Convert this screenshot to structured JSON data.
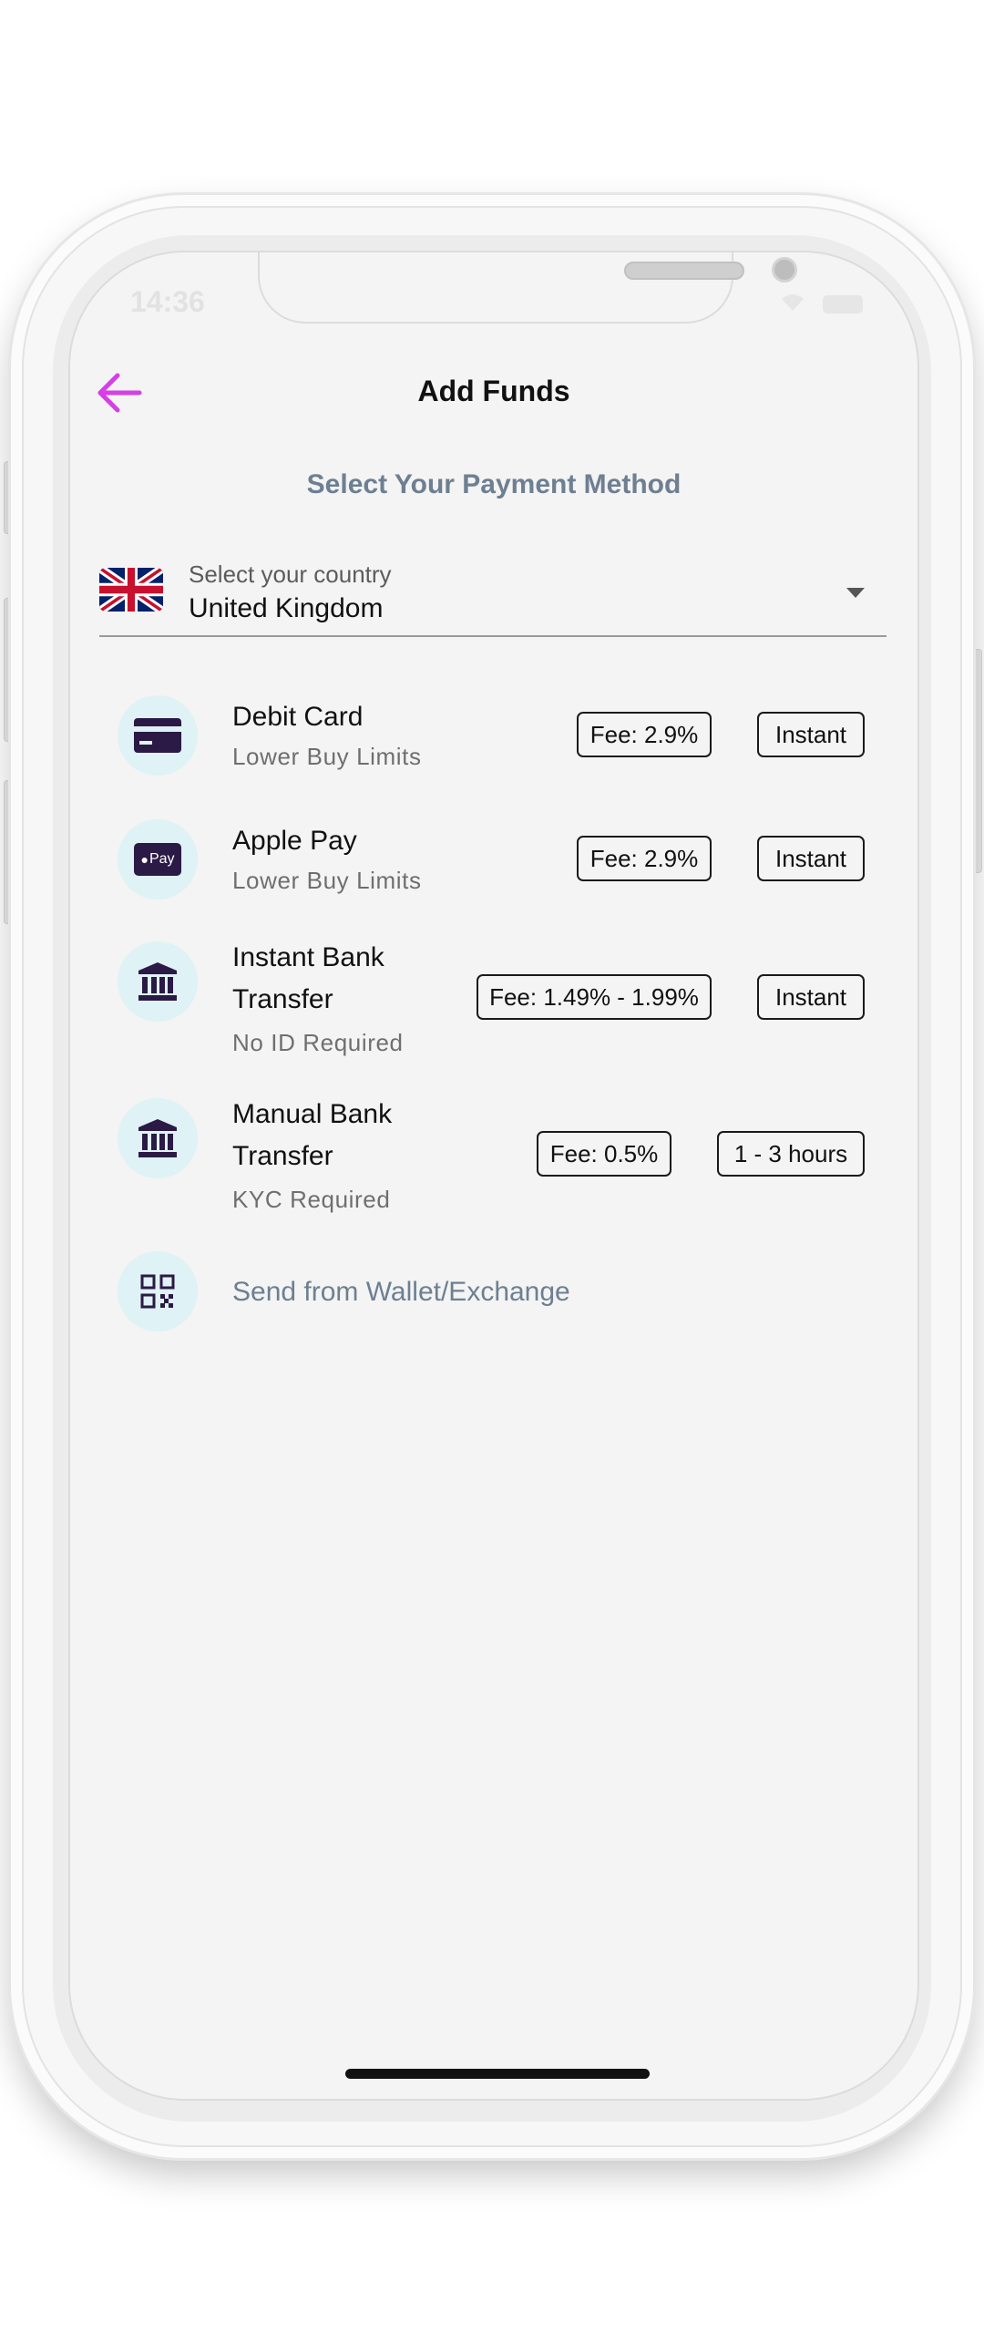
{
  "status_bar": {
    "time": "14:36"
  },
  "header": {
    "title": "Add Funds"
  },
  "section_title": "Select Your Payment Method",
  "country": {
    "label": "Select your country",
    "value": "United Kingdom"
  },
  "methods": [
    {
      "name": "Debit Card",
      "subtitle": "Lower Buy Limits",
      "fee": "Fee: 2.9%",
      "speed": "Instant",
      "icon": "credit-card-icon"
    },
    {
      "name": "Apple Pay",
      "subtitle": "Lower Buy Limits",
      "fee": "Fee: 2.9%",
      "speed": "Instant",
      "icon": "apple-pay-icon",
      "icon_text": "Pay"
    },
    {
      "name_line1": "Instant Bank",
      "name_line2": "Transfer",
      "subtitle": "No ID Required",
      "fee": "Fee: 1.49% - 1.99%",
      "speed": "Instant",
      "icon": "bank-icon"
    },
    {
      "name_line1": "Manual Bank",
      "name_line2": "Transfer",
      "subtitle": "KYC Required",
      "fee": "Fee: 0.5%",
      "speed": "1 - 3 hours",
      "icon": "bank-icon"
    }
  ],
  "wallet": {
    "label": "Send from Wallet/Exchange",
    "icon": "qr-code-icon"
  },
  "colors": {
    "accent": "#d63ee6",
    "icon_bg": "#dff2f5",
    "icon_fg": "#2b1a45",
    "muted_title": "#6e7f92",
    "screen_bg": "#f3f4f3"
  }
}
